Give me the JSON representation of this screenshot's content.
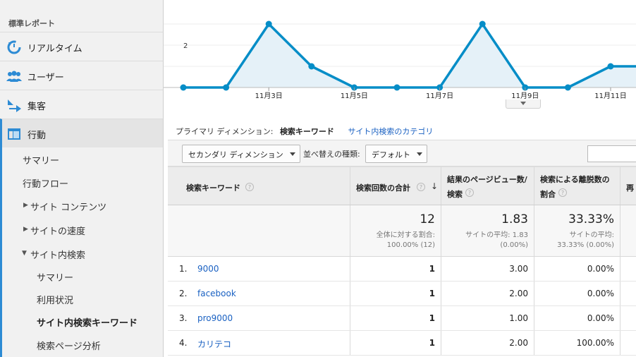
{
  "sidebar": {
    "section_title": "標準レポート",
    "main_items": [
      {
        "label": "リアルタイム",
        "icon": "realtime-icon"
      },
      {
        "label": "ユーザー",
        "icon": "users-icon"
      },
      {
        "label": "集客",
        "icon": "acquisition-icon"
      },
      {
        "label": "行動",
        "icon": "behavior-icon"
      }
    ],
    "sub_items": [
      {
        "label": "サマリー"
      },
      {
        "label": "行動フロー"
      },
      {
        "label": "サイト コンテンツ"
      },
      {
        "label": "サイトの速度"
      },
      {
        "label": "サイト内検索"
      },
      {
        "label": "サマリー"
      },
      {
        "label": "利用状況"
      },
      {
        "label": "サイト内検索キーワード"
      },
      {
        "label": "検索ページ分析"
      }
    ]
  },
  "chart_data": {
    "type": "area",
    "x": [
      "11月1日",
      "11月2日",
      "11月3日",
      "11月4日",
      "11月5日",
      "11月6日",
      "11月7日",
      "11月8日",
      "11月9日",
      "11月10日",
      "11月11日",
      "11月12日"
    ],
    "values": [
      0,
      0,
      3,
      1,
      0,
      0,
      0,
      3,
      0,
      0,
      1,
      1
    ],
    "tick_labels": [
      "11月3日",
      "11月5日",
      "11月7日",
      "11月9日",
      "11月11日"
    ],
    "y_tick_labels": [
      "2"
    ],
    "ylim": [
      0,
      4
    ],
    "grid": true,
    "color": "#058dc7",
    "fill": "#e5f1f8"
  },
  "dimension_bar": {
    "label": "プライマリ ディメンション:",
    "active": "検索キーワード",
    "link": "サイト内検索のカテゴリ"
  },
  "toolbar": {
    "secondary_dimension": "セカンダリ ディメンション",
    "sort_label": "並べ替えの種類:",
    "sort_value": "デフォルト"
  },
  "table": {
    "headers": {
      "keyword": "検索キーワード",
      "searches": "検索回数の合計",
      "pageviews_line1": "結果のページビュー数/",
      "pageviews_line2": "検索",
      "exits_line1": "検索による離脱数の",
      "exits_line2": "割合",
      "partial": "再"
    },
    "help_mark": "?",
    "sort_arrow": "↓",
    "totals": {
      "searches": "12",
      "searches_sub1": "全体に対する割合:",
      "searches_sub2": "100.00% (12)",
      "pageviews": "1.83",
      "pageviews_sub1": "サイトの平均: 1.83",
      "pageviews_sub2": "(0.00%)",
      "exits": "33.33%",
      "exits_sub1": "サイトの平均:",
      "exits_sub2": "33.33% (0.00%)"
    },
    "rows": [
      {
        "idx": "1.",
        "keyword": "9000",
        "searches": "1",
        "pageviews": "3.00",
        "exits": "0.00%"
      },
      {
        "idx": "2.",
        "keyword": "facebook",
        "searches": "1",
        "pageviews": "2.00",
        "exits": "0.00%"
      },
      {
        "idx": "3.",
        "keyword": "pro9000",
        "searches": "1",
        "pageviews": "1.00",
        "exits": "0.00%"
      },
      {
        "idx": "4.",
        "keyword": "カリテコ",
        "searches": "1",
        "pageviews": "2.00",
        "exits": "100.00%"
      }
    ]
  }
}
